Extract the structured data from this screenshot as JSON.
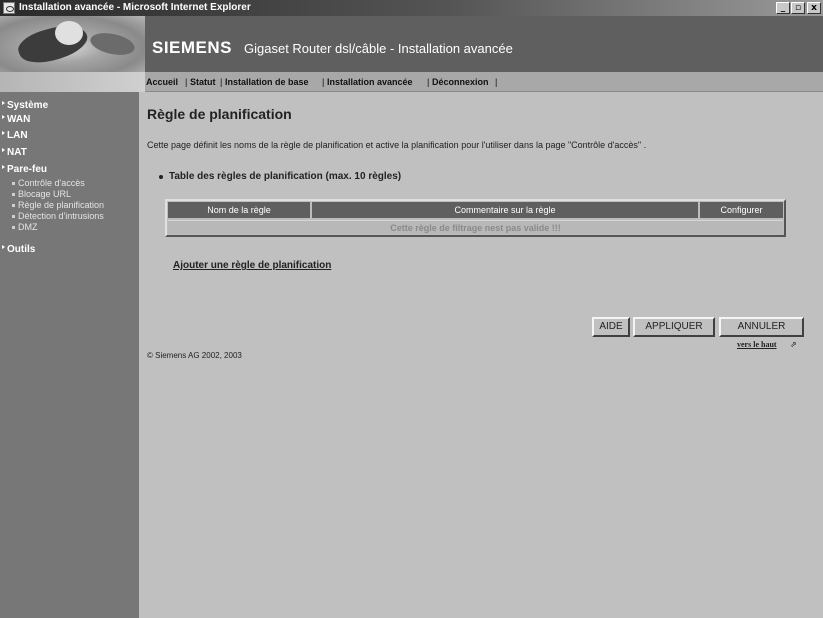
{
  "window": {
    "title": "Installation avancée - Microsoft Internet Explorer",
    "controls": {
      "minimize": "_",
      "maximize": "▫",
      "close": "x"
    }
  },
  "banner": {
    "brand": "SIEMENS",
    "product": "Gigaset Router dsl/câble  -  Installation avancée"
  },
  "nav": {
    "items": [
      "Accueil",
      "Statut",
      "Installation de base",
      "Installation avancée",
      "Déconnexion"
    ],
    "separator": "|"
  },
  "sidebar": {
    "items": [
      {
        "label": "Système"
      },
      {
        "label": "WAN"
      },
      {
        "label": "LAN"
      },
      {
        "label": "NAT"
      },
      {
        "label": "Pare-feu"
      }
    ],
    "firewall_subitems": [
      "Contrôle d'accès",
      "Blocage URL",
      "Règle de planification",
      "Détection d'intrusions",
      "DMZ"
    ],
    "tools": "Outils"
  },
  "main": {
    "title": "Règle de planification",
    "description": "Cette page définit les noms de la règle de planification et active la planification pour l'utiliser dans la page \"Contrôle d'accès\" .",
    "table_heading": "Table des règles de planification (max. 10 règles)",
    "table": {
      "columns": [
        "Nom de la règle",
        "Commentaire sur la règle",
        "Configurer"
      ],
      "empty_message": "Cette règle de filtrage nest pas valide !!!"
    },
    "add_link": "Ajouter une règle de planification",
    "buttons": {
      "help": "AIDE",
      "apply": "APPLIQUER",
      "cancel": "ANNULER"
    },
    "top_link": "vers le haut",
    "top_arrow": "⇗",
    "copyright": "© Siemens AG 2002, 2003"
  },
  "colors": {
    "banner_bg": "#5f5f5f",
    "sidebar_bg": "#777777",
    "content_bg": "#c0c0c0",
    "table_header_bg": "#5f5f5f"
  }
}
